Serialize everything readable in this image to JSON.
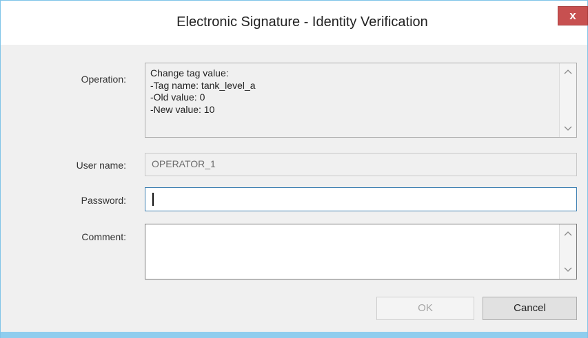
{
  "window": {
    "title": "Electronic Signature - Identity Verification",
    "close_label": "x"
  },
  "form": {
    "operation_label": "Operation:",
    "operation_lines": [
      "Change tag value:",
      "-Tag name: tank_level_a",
      "-Old value: 0",
      "-New value: 10"
    ],
    "username_label": "User name:",
    "username_value": "OPERATOR_1",
    "password_label": "Password:",
    "password_value": "",
    "comment_label": "Comment:",
    "comment_value": ""
  },
  "scroll": {
    "up_arrow": "^",
    "down_arrow": "v"
  },
  "buttons": {
    "ok_label": "OK",
    "cancel_label": "Cancel"
  },
  "colors": {
    "accent_border": "#7fc4e8",
    "close_button": "#c75050",
    "focus_border": "#3c7fb1"
  }
}
